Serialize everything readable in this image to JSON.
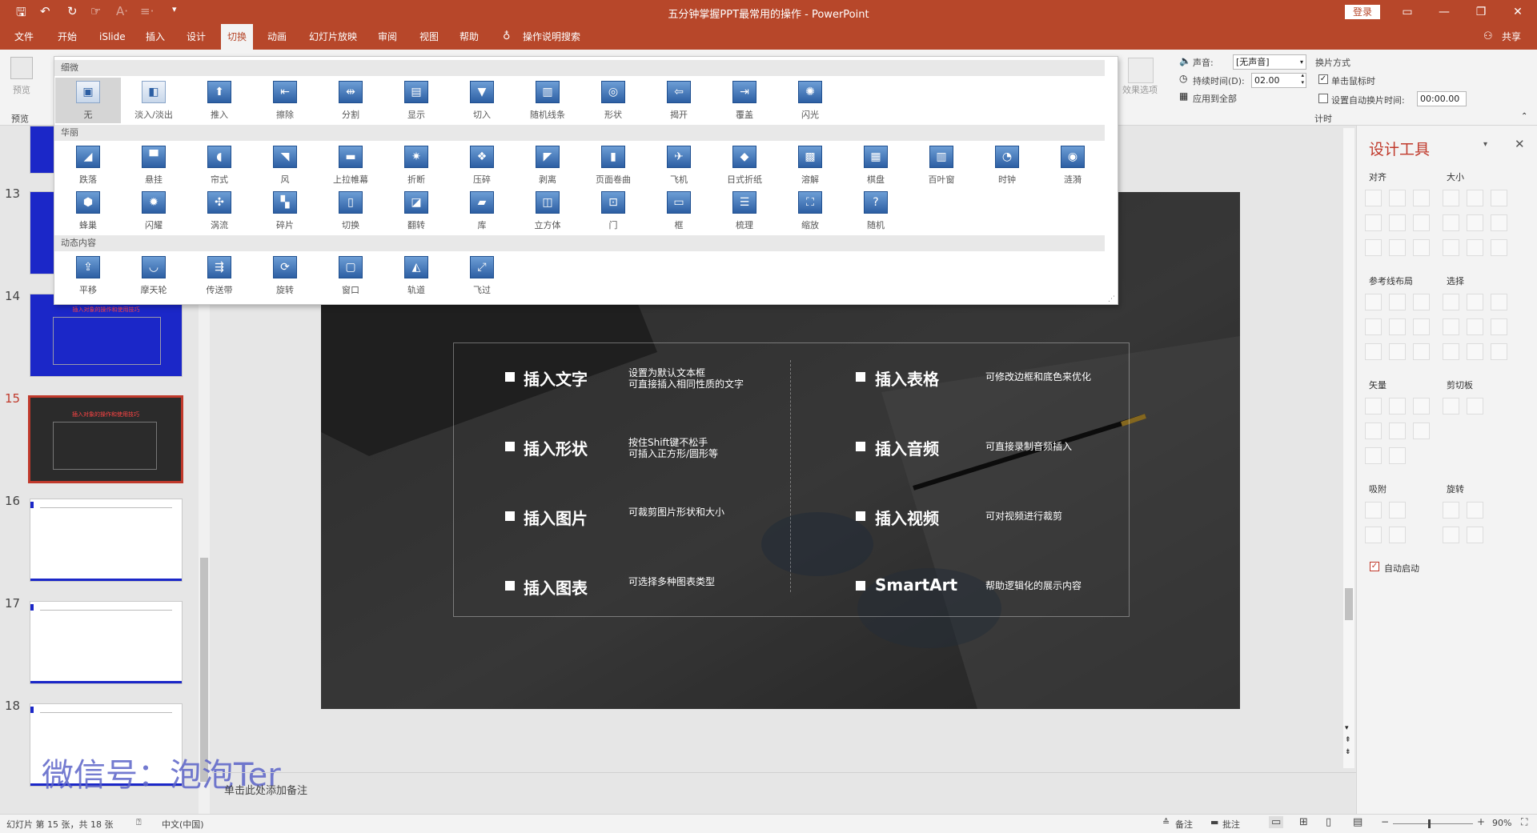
{
  "window": {
    "title": "五分钟掌握PPT最常用的操作  -  PowerPoint",
    "login": "登录"
  },
  "menu": [
    "文件",
    "开始",
    "iSlide",
    "插入",
    "设计",
    "切换",
    "动画",
    "幻灯片放映",
    "审阅",
    "视图",
    "帮助",
    "操作说明搜索"
  ],
  "menu_active": "切换",
  "share": "共享",
  "ribbon": {
    "preview_label": "预览",
    "preview_group": "预览",
    "effect_options": "效果选项",
    "sound_label": "声音:",
    "sound_value": "[无声音]",
    "duration_label": "持续时间(D):",
    "duration_value": "02.00",
    "apply_all": "应用到全部",
    "advance_title": "换片方式",
    "on_click": "单击鼠标时",
    "auto_after": "设置自动换片时间:",
    "auto_value": "00:00.00",
    "timing_group": "计时"
  },
  "gallery": {
    "sections": [
      {
        "title": "细微",
        "items": [
          "无",
          "淡入/淡出",
          "推入",
          "擦除",
          "分割",
          "显示",
          "切入",
          "随机线条",
          "形状",
          "揭开",
          "覆盖",
          "闪光"
        ]
      },
      {
        "title": "华丽",
        "items": [
          "跌落",
          "悬挂",
          "帘式",
          "风",
          "上拉帷幕",
          "折断",
          "压碎",
          "剥离",
          "页面卷曲",
          "飞机",
          "日式折纸",
          "溶解",
          "棋盘",
          "百叶窗",
          "时钟",
          "涟漪",
          "蜂巢",
          "闪耀",
          "涡流",
          "碎片",
          "切换",
          "翻转",
          "库",
          "立方体",
          "门",
          "框",
          "梳理",
          "缩放",
          "随机"
        ]
      },
      {
        "title": "动态内容",
        "items": [
          "平移",
          "摩天轮",
          "传送带",
          "旋转",
          "窗口",
          "轨道",
          "飞过"
        ]
      }
    ],
    "selected": "无"
  },
  "thumbnails": [
    {
      "num": "13",
      "mini_title": ""
    },
    {
      "num": "14",
      "mini_title": "插入对象的操作和使用技巧"
    },
    {
      "num": "15",
      "mini_title": "插入对象的操作和使用技巧"
    },
    {
      "num": "16",
      "mini_title": ""
    },
    {
      "num": "17",
      "mini_title": ""
    },
    {
      "num": "18",
      "mini_title": ""
    }
  ],
  "current_slide": "15",
  "slide": {
    "rows": [
      {
        "left_title": "插入文字",
        "left_desc1": "设置为默认文本框",
        "left_desc2": "可直接插入相同性质的文字",
        "right_title": "插入表格",
        "right_desc1": "可修改边框和底色来优化",
        "right_desc2": ""
      },
      {
        "left_title": "插入形状",
        "left_desc1": "按住Shift键不松手",
        "left_desc2": "可插入正方形/圆形等",
        "right_title": "插入音频",
        "right_desc1": "可直接录制音频插入",
        "right_desc2": ""
      },
      {
        "left_title": "插入图片",
        "left_desc1": "可裁剪图片形状和大小",
        "left_desc2": "",
        "right_title": "插入视频",
        "right_desc1": "可对视频进行裁剪",
        "right_desc2": ""
      },
      {
        "left_title": "插入图表",
        "left_desc1": "可选择多种图表类型",
        "left_desc2": "",
        "right_title": "SmartArt",
        "right_desc1": "帮助逻辑化的展示内容",
        "right_desc2": ""
      }
    ]
  },
  "notes_placeholder": "单击此处添加备注",
  "watermark": "微信号：泡泡Ter",
  "panel": {
    "title": "设计工具",
    "sections": [
      "对齐",
      "大小",
      "参考线布局",
      "选择",
      "矢量",
      "剪切板",
      "吸附",
      "旋转"
    ],
    "autostart": "自动启动"
  },
  "status": {
    "slide_info": "幻灯片 第 15 张，共 18 张",
    "language": "中文(中国)",
    "notes": "备注",
    "comments": "批注",
    "zoom": "90%"
  },
  "colors": {
    "accent": "#b7472a",
    "slide_blue": "#1b27c8"
  }
}
